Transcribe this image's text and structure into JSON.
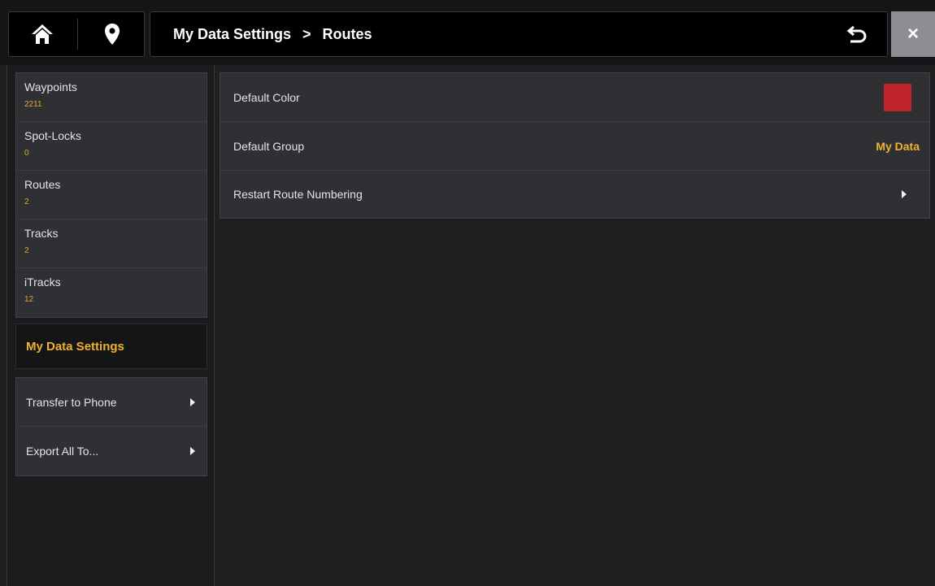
{
  "header": {
    "home_icon": "home-icon",
    "location_icon": "map-pin-icon",
    "breadcrumb": [
      "My Data Settings",
      "Routes"
    ],
    "breadcrumb_separator": ">",
    "back_icon": "undo-arrow-icon",
    "close_label": "×"
  },
  "sidebar": {
    "categories": [
      {
        "label": "Waypoints",
        "count": "2211"
      },
      {
        "label": "Spot-Locks",
        "count": "0"
      },
      {
        "label": "Routes",
        "count": "2"
      },
      {
        "label": "Tracks",
        "count": "2"
      },
      {
        "label": "iTracks",
        "count": "12"
      }
    ],
    "selected": "My Data Settings",
    "actions": [
      {
        "label": "Transfer to Phone"
      },
      {
        "label": "Export All To..."
      }
    ]
  },
  "settings": {
    "rows": [
      {
        "label": "Default Color",
        "color": "#c0242b"
      },
      {
        "label": "Default Group",
        "value": "My Data"
      },
      {
        "label": "Restart Route Numbering"
      }
    ]
  },
  "colors": {
    "accent": "#f0b22c",
    "count": "#e3a82a"
  }
}
